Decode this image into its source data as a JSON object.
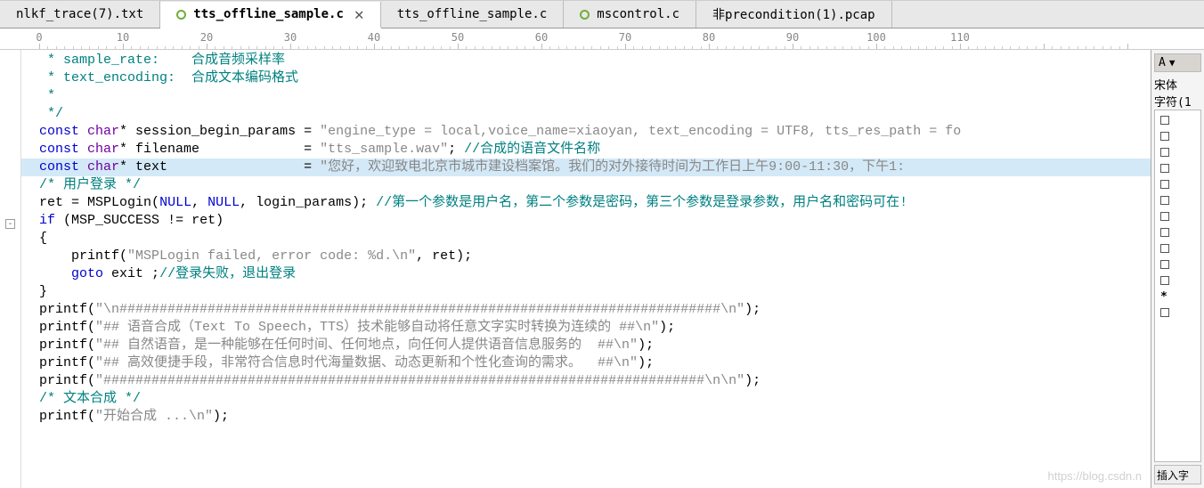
{
  "tabs": [
    {
      "label": "nlkf_trace(7).txt",
      "hasDot": false,
      "active": false,
      "hasClose": false
    },
    {
      "label": "tts_offline_sample.c",
      "hasDot": true,
      "active": true,
      "hasClose": true
    },
    {
      "label": "tts_offline_sample.c",
      "hasDot": false,
      "active": false,
      "hasClose": false
    },
    {
      "label": "mscontrol.c",
      "hasDot": true,
      "active": false,
      "hasClose": false
    },
    {
      "label": "非precondition(1).pcap",
      "hasDot": false,
      "active": false,
      "hasClose": false
    }
  ],
  "ruler": [
    0,
    10,
    20,
    30,
    40,
    50,
    60,
    70,
    80,
    90,
    100,
    110
  ],
  "code": {
    "lines": [
      {
        "cls": "",
        "html": [
          [
            "c-comment",
            " * sample_rate:    合成音频采样率"
          ]
        ]
      },
      {
        "cls": "",
        "html": [
          [
            "c-comment",
            " * text_encoding:  合成文本编码格式"
          ]
        ]
      },
      {
        "cls": "",
        "html": [
          [
            "c-comment",
            " *"
          ]
        ]
      },
      {
        "cls": "",
        "html": [
          [
            "c-comment",
            " */"
          ]
        ]
      },
      {
        "cls": "",
        "mark": "y",
        "html": [
          [
            "c-kw",
            "const "
          ],
          [
            "c-type",
            "char"
          ],
          [
            "c-punct",
            "* "
          ],
          [
            "",
            "session_begin_params "
          ],
          [
            "c-punct",
            "= "
          ],
          [
            "c-str",
            "\"engine_type = local,voice_name=xiaoyan, text_encoding = UTF8, tts_res_path = fo"
          ]
        ]
      },
      {
        "cls": "",
        "html": [
          [
            "c-kw",
            "const "
          ],
          [
            "c-type",
            "char"
          ],
          [
            "c-punct",
            "* "
          ],
          [
            "",
            "filename             "
          ],
          [
            "c-punct",
            "= "
          ],
          [
            "c-str",
            "\"tts_sample.wav\""
          ],
          [
            "c-punct",
            "; "
          ],
          [
            "c-comment",
            "//合成的语音文件名称"
          ]
        ]
      },
      {
        "cls": "hl",
        "mark": "y",
        "html": [
          [
            "c-kw",
            "const "
          ],
          [
            "c-type",
            "char"
          ],
          [
            "c-punct",
            "* "
          ],
          [
            "",
            "text                 "
          ],
          [
            "c-punct",
            "= "
          ],
          [
            "c-str",
            "\"您好，欢迎致电北京市城市建设档案馆。我们的对外接待时间为工作日上午9:00-11:30，下午1:"
          ]
        ]
      },
      {
        "cls": "",
        "html": [
          [
            "c-comment",
            "/* 用户登录 */"
          ]
        ]
      },
      {
        "cls": "",
        "html": [
          [
            "",
            "ret "
          ],
          [
            "c-punct",
            "= "
          ],
          [
            "c-fn",
            "MSPLogin"
          ],
          [
            "c-punct",
            "("
          ],
          [
            "c-kw",
            "NULL"
          ],
          [
            "c-punct",
            ", "
          ],
          [
            "c-kw",
            "NULL"
          ],
          [
            "c-punct",
            ", "
          ],
          [
            "",
            "login_params"
          ],
          [
            "c-punct",
            "); "
          ],
          [
            "c-comment",
            "//第一个参数是用户名，第二个参数是密码，第三个参数是登录参数，用户名和密码可在!"
          ]
        ]
      },
      {
        "cls": "",
        "html": [
          [
            "c-kw",
            "if "
          ],
          [
            "c-punct",
            "("
          ],
          [
            "",
            "MSP_SUCCESS "
          ],
          [
            "c-punct",
            "!= "
          ],
          [
            "",
            "ret"
          ],
          [
            "c-punct",
            ")"
          ]
        ]
      },
      {
        "cls": "",
        "html": [
          [
            "c-punct",
            "{"
          ]
        ]
      },
      {
        "cls": "",
        "html": [
          [
            "",
            "    "
          ],
          [
            "c-fn",
            "printf"
          ],
          [
            "c-punct",
            "("
          ],
          [
            "c-str",
            "\"MSPLogin failed, error code: %d.\\n\""
          ],
          [
            "c-punct",
            ", "
          ],
          [
            "",
            "ret"
          ],
          [
            "c-punct",
            ");"
          ]
        ]
      },
      {
        "cls": "",
        "html": [
          [
            "",
            "    "
          ],
          [
            "c-kw",
            "goto "
          ],
          [
            "",
            "exit "
          ],
          [
            "c-punct",
            ";"
          ],
          [
            "c-comment",
            "//登录失败，退出登录"
          ]
        ]
      },
      {
        "cls": "",
        "html": [
          [
            "c-punct",
            "}"
          ]
        ]
      },
      {
        "cls": "",
        "html": [
          [
            "",
            ""
          ]
        ]
      },
      {
        "cls": "",
        "html": [
          [
            "c-fn",
            "printf"
          ],
          [
            "c-punct",
            "("
          ],
          [
            "c-str",
            "\"\\n###########################################################################\\n\""
          ],
          [
            "c-punct",
            ");"
          ]
        ]
      },
      {
        "cls": "",
        "html": [
          [
            "c-fn",
            "printf"
          ],
          [
            "c-punct",
            "("
          ],
          [
            "c-str",
            "\"## 语音合成（Text To Speech，TTS）技术能够自动将任意文字实时转换为连续的 ##\\n\""
          ],
          [
            "c-punct",
            ");"
          ]
        ]
      },
      {
        "cls": "",
        "html": [
          [
            "c-fn",
            "printf"
          ],
          [
            "c-punct",
            "("
          ],
          [
            "c-str",
            "\"## 自然语音，是一种能够在任何时间、任何地点，向任何人提供语音信息服务的  ##\\n\""
          ],
          [
            "c-punct",
            ");"
          ]
        ]
      },
      {
        "cls": "",
        "html": [
          [
            "c-fn",
            "printf"
          ],
          [
            "c-punct",
            "("
          ],
          [
            "c-str",
            "\"## 高效便捷手段，非常符合信息时代海量数据、动态更新和个性化查询的需求。  ##\\n\""
          ],
          [
            "c-punct",
            ");"
          ]
        ]
      },
      {
        "cls": "",
        "html": [
          [
            "c-fn",
            "printf"
          ],
          [
            "c-punct",
            "("
          ],
          [
            "c-str",
            "\"###########################################################################\\n\\n\""
          ],
          [
            "c-punct",
            ");"
          ]
        ]
      },
      {
        "cls": "",
        "html": [
          [
            "",
            ""
          ]
        ]
      },
      {
        "cls": "",
        "html": [
          [
            "c-comment",
            "/* 文本合成 */"
          ]
        ]
      },
      {
        "cls": "",
        "html": [
          [
            "c-fn",
            "printf"
          ],
          [
            "c-punct",
            "("
          ],
          [
            "c-str",
            "\"开始合成 ...\\n\""
          ],
          [
            "c-punct",
            ");"
          ]
        ]
      }
    ]
  },
  "sidepanel": {
    "headLabel": "A",
    "info1": "宋体",
    "info2": "字符(1",
    "symbolCount": 13,
    "asteriskIndex": 11,
    "footer": "插入字"
  },
  "watermark": "https://blog.csdn.n"
}
